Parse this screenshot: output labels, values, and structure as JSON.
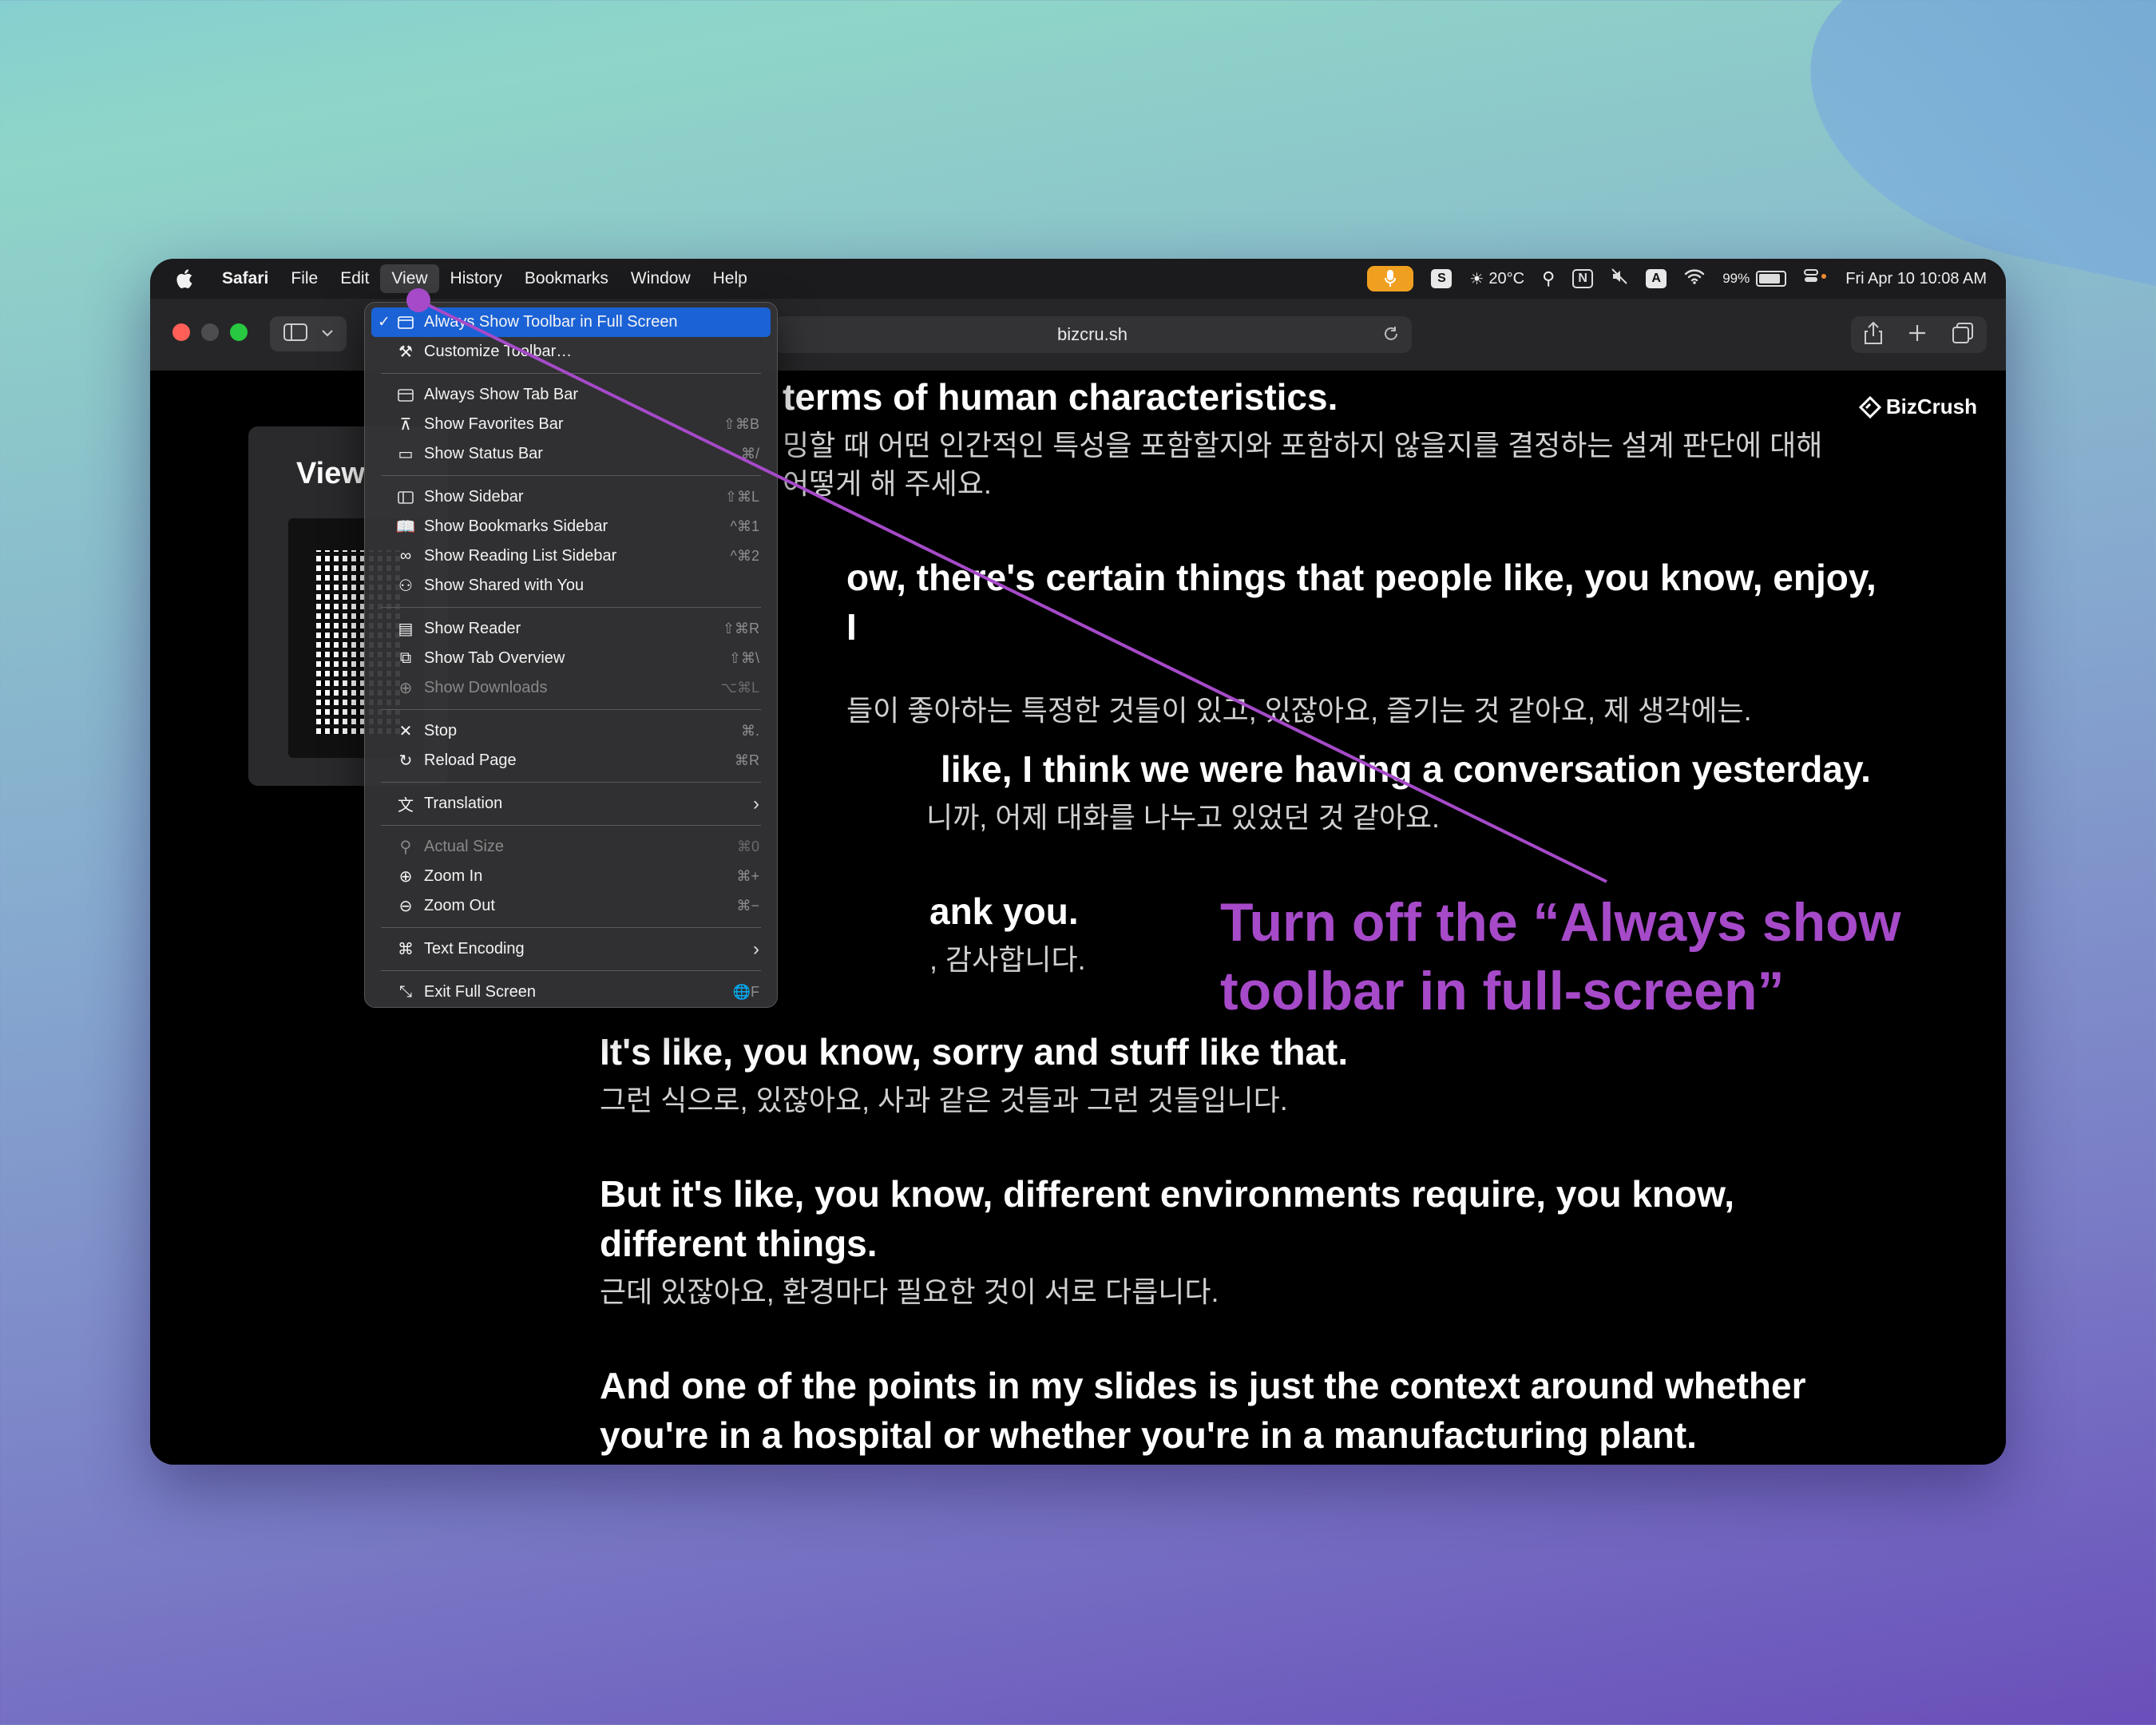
{
  "menubar": {
    "app": "Safari",
    "items": [
      "File",
      "Edit",
      "View",
      "History",
      "Bookmarks",
      "Window",
      "Help"
    ],
    "status": {
      "s_badge": "S",
      "weather": "20°C",
      "n_badge": "N",
      "a_badge": "A",
      "battery": "99%",
      "datetime": "Fri Apr 10  10:08 AM"
    }
  },
  "toolbar": {
    "url": "bizcru.sh"
  },
  "page": {
    "logo": "BizCrush",
    "qr_title": "View",
    "subtitles": [
      {
        "en": "terms of human characteristics.",
        "ko": "밍할 때 어떤 인간적인 특성을 포함할지와 포함하지 않을지를 결정하는 설계 판단에 대해 어떻게 해 주세요."
      },
      {
        "en": "ow, there's certain things that people like, you know, enjoy, I",
        "ko": "들이 좋아하는 특정한 것들이 있고, 있잖아요, 즐기는 것 같아요, 제 생각에는."
      },
      {
        "en": "like, I think we were having a conversation yesterday.",
        "ko": "니까, 어제 대화를 나누고 있었던 것 같아요."
      },
      {
        "en": "ank you.",
        "ko": ", 감사합니다."
      },
      {
        "en": "It's like, you know, sorry and stuff like that.",
        "ko": "그런 식으로, 있잖아요, 사과 같은 것들과 그런 것들입니다."
      },
      {
        "en": "But it's like, you know, different environments require, you know, different things.",
        "ko": "근데 있잖아요, 환경마다 필요한 것이 서로 다릅니다."
      },
      {
        "en": "And one of the points in my slides is just the context around whether you're in a hospital or whether you're in a manufacturing plant.",
        "ko": ""
      }
    ]
  },
  "view_menu": {
    "items": [
      {
        "label": "Always Show Toolbar in Full Screen",
        "shortcut": "",
        "checked": true,
        "icon": "toolbar-icon",
        "highlight": true
      },
      {
        "label": "Customize Toolbar…",
        "shortcut": "",
        "icon": "wrench-icon"
      },
      {
        "sep": true
      },
      {
        "label": "Always Show Tab Bar",
        "shortcut": "",
        "icon": "tab-bar-icon"
      },
      {
        "label": "Show Favorites Bar",
        "shortcut": "⇧⌘B",
        "icon": "favorites-bar-icon"
      },
      {
        "label": "Show Status Bar",
        "shortcut": "⌘/",
        "icon": "status-bar-icon"
      },
      {
        "sep": true
      },
      {
        "label": "Show Sidebar",
        "shortcut": "⇧⌘L",
        "icon": "sidebar-icon"
      },
      {
        "label": "Show Bookmarks Sidebar",
        "shortcut": "^⌘1",
        "icon": "book-icon"
      },
      {
        "label": "Show Reading List Sidebar",
        "shortcut": "^⌘2",
        "icon": "glasses-icon"
      },
      {
        "label": "Show Shared with You",
        "shortcut": "",
        "icon": "shared-icon"
      },
      {
        "sep": true
      },
      {
        "label": "Show Reader",
        "shortcut": "⇧⌘R",
        "icon": "reader-icon"
      },
      {
        "label": "Show Tab Overview",
        "shortcut": "⇧⌘\\",
        "icon": "tab-overview-icon"
      },
      {
        "label": "Show Downloads",
        "shortcut": "⌥⌘L",
        "icon": "download-icon",
        "disabled": true
      },
      {
        "sep": true
      },
      {
        "label": "Stop",
        "shortcut": "⌘.",
        "icon": "close-icon"
      },
      {
        "label": "Reload Page",
        "shortcut": "⌘R",
        "icon": "reload-icon"
      },
      {
        "sep": true
      },
      {
        "label": "Translation",
        "shortcut": "",
        "icon": "translate-icon",
        "submenu": true
      },
      {
        "sep": true
      },
      {
        "label": "Actual Size",
        "shortcut": "⌘0",
        "icon": "magnifier-icon",
        "disabled": true
      },
      {
        "label": "Zoom In",
        "shortcut": "⌘+",
        "icon": "zoom-in-icon"
      },
      {
        "label": "Zoom Out",
        "shortcut": "⌘−",
        "icon": "zoom-out-icon"
      },
      {
        "sep": true
      },
      {
        "label": "Text Encoding",
        "shortcut": "",
        "icon": "command-icon",
        "submenu": true
      },
      {
        "sep": true
      },
      {
        "label": "Exit Full Screen",
        "shortcut": "🌐F",
        "icon": "exit-fullscreen-icon"
      }
    ]
  },
  "annotation": {
    "line1": "Turn off the “Always show",
    "line2": "toolbar in full-screen”",
    "color": "#a64ac9"
  }
}
